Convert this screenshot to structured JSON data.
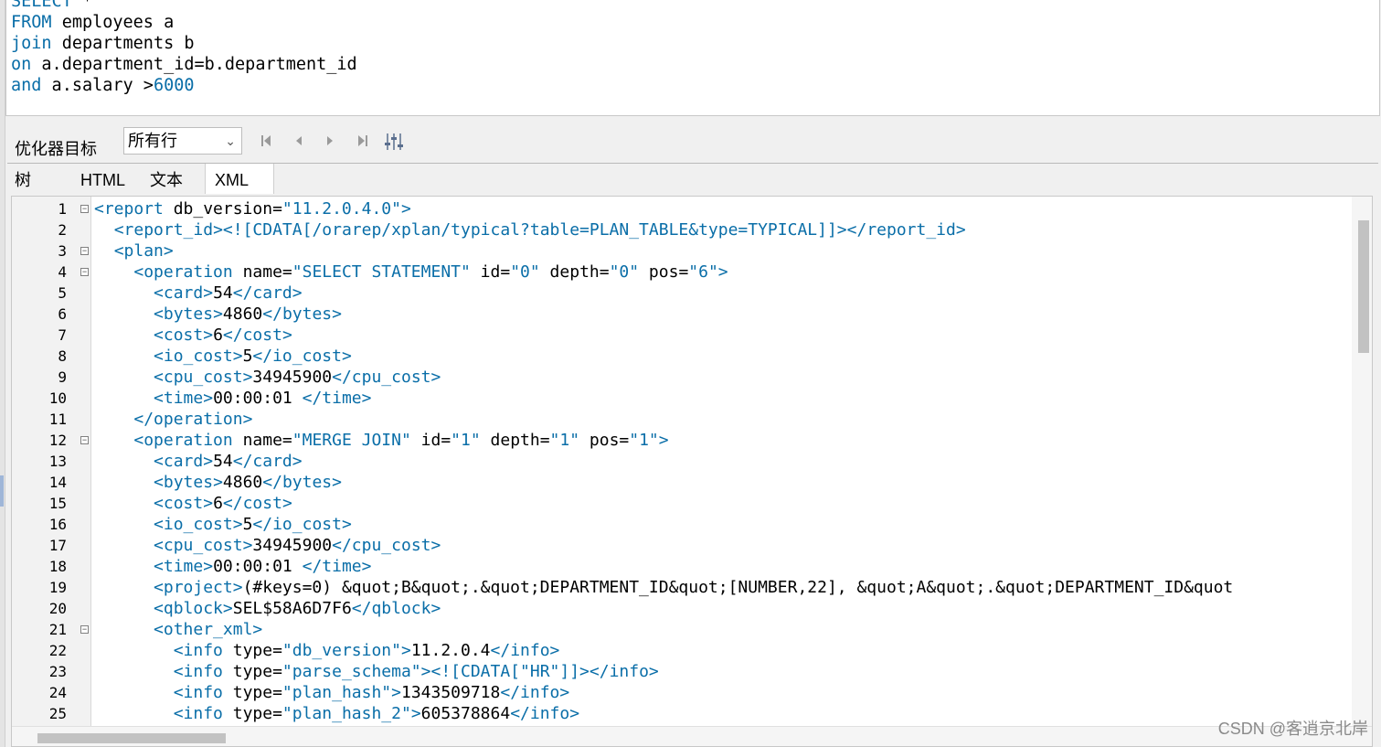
{
  "sql_editor": {
    "lines": [
      {
        "k": "SELECT",
        "r": " *"
      },
      {
        "k": "FROM",
        "r": " employees a"
      },
      {
        "k": "join",
        "r": " departments b"
      },
      {
        "k": "on",
        "r": " a.department_id=b.department_id"
      },
      {
        "k": "and",
        "r": " a.salary >",
        "n": "6000"
      }
    ]
  },
  "toolbar": {
    "optimizer_label": "优化器目标",
    "optimizer_value": "所有行",
    "nav_first_icon": "first-page-icon",
    "nav_prev_icon": "prev-icon",
    "nav_next_icon": "next-icon",
    "nav_last_icon": "last-page-icon",
    "settings_icon": "sliders-icon"
  },
  "tabs": [
    {
      "label": "树",
      "active": false
    },
    {
      "label": "HTML",
      "active": false
    },
    {
      "label": "文本",
      "active": false
    },
    {
      "label": "XML",
      "active": true
    }
  ],
  "code": {
    "lines": [
      {
        "n": "1",
        "fold": true,
        "text": "<report db_version=\"11.2.0.4.0\">"
      },
      {
        "n": "2",
        "fold": false,
        "text": "  <report_id><![CDATA[/orarep/xplan/typical?table=PLAN_TABLE&type=TYPICAL]]></report_id>"
      },
      {
        "n": "3",
        "fold": true,
        "text": "  <plan>"
      },
      {
        "n": "4",
        "fold": true,
        "text": "    <operation name=\"SELECT STATEMENT\" id=\"0\" depth=\"0\" pos=\"6\">"
      },
      {
        "n": "5",
        "fold": false,
        "text": "      <card>54</card>"
      },
      {
        "n": "6",
        "fold": false,
        "text": "      <bytes>4860</bytes>"
      },
      {
        "n": "7",
        "fold": false,
        "text": "      <cost>6</cost>"
      },
      {
        "n": "8",
        "fold": false,
        "text": "      <io_cost>5</io_cost>"
      },
      {
        "n": "9",
        "fold": false,
        "text": "      <cpu_cost>34945900</cpu_cost>"
      },
      {
        "n": "10",
        "fold": false,
        "text": "      <time>00:00:01 </time>"
      },
      {
        "n": "11",
        "fold": false,
        "text": "    </operation>"
      },
      {
        "n": "12",
        "fold": true,
        "text": "    <operation name=\"MERGE JOIN\" id=\"1\" depth=\"1\" pos=\"1\">"
      },
      {
        "n": "13",
        "fold": false,
        "text": "      <card>54</card>"
      },
      {
        "n": "14",
        "fold": false,
        "text": "      <bytes>4860</bytes>"
      },
      {
        "n": "15",
        "fold": false,
        "text": "      <cost>6</cost>"
      },
      {
        "n": "16",
        "fold": false,
        "text": "      <io_cost>5</io_cost>"
      },
      {
        "n": "17",
        "fold": false,
        "text": "      <cpu_cost>34945900</cpu_cost>"
      },
      {
        "n": "18",
        "fold": false,
        "text": "      <time>00:00:01 </time>"
      },
      {
        "n": "19",
        "fold": false,
        "text": "      <project>(#keys=0) &quot;B&quot;.&quot;DEPARTMENT_ID&quot;[NUMBER,22], &quot;A&quot;.&quot;DEPARTMENT_ID&quot"
      },
      {
        "n": "20",
        "fold": false,
        "text": "      <qblock>SEL$58A6D7F6</qblock>"
      },
      {
        "n": "21",
        "fold": true,
        "text": "      <other_xml>"
      },
      {
        "n": "22",
        "fold": false,
        "text": "        <info type=\"db_version\">11.2.0.4</info>"
      },
      {
        "n": "23",
        "fold": false,
        "text": "        <info type=\"parse_schema\"><![CDATA[\"HR\"]]></info>"
      },
      {
        "n": "24",
        "fold": false,
        "text": "        <info type=\"plan_hash\">1343509718</info>"
      },
      {
        "n": "25",
        "fold": false,
        "text": "        <info type=\"plan_hash_2\">605378864</info>"
      }
    ]
  },
  "watermark": "CSDN @客逍京北岸"
}
